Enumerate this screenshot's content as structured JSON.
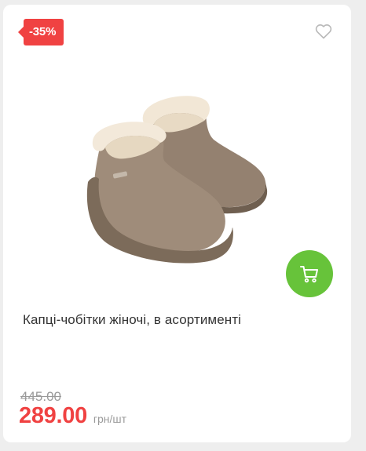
{
  "product": {
    "discount_badge": "-35%",
    "title": "Капці-чобітки жіночі, в асортименті",
    "old_price": "445.00",
    "price": "289.00",
    "unit": "грн/шт"
  },
  "icons": {
    "favorite": "heart-outline-icon",
    "cart": "cart-icon"
  },
  "colors": {
    "badge": "#f04242",
    "price": "#f04242",
    "cart_button": "#67c33a"
  }
}
